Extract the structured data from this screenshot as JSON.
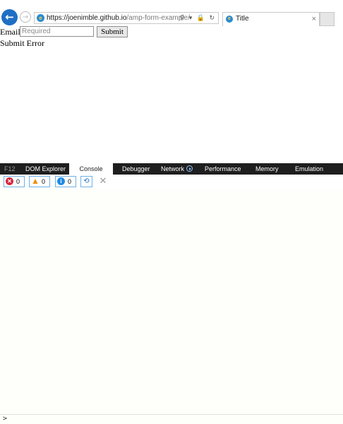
{
  "browser": {
    "url_host": "https://joenimble.github.io",
    "url_path": "/amp-form-example/",
    "address_icons": "⚲ ▾ 🔒 ↻",
    "tab_title": "Title",
    "tab_close": "×",
    "back_glyph": "←",
    "forward_glyph": "→",
    "site_icon": "e"
  },
  "page": {
    "email_label": "Email",
    "email_placeholder": "Required",
    "email_value": "",
    "submit_label": "Submit",
    "submit_error": "Submit Error"
  },
  "devtools": {
    "tabs": {
      "f12": "F12",
      "dom_explorer": "DOM Explorer",
      "console": "Console",
      "debugger": "Debugger",
      "network": "Network",
      "performance": "Performance",
      "memory": "Memory",
      "emulation": "Emulation"
    },
    "active_tab": "Console",
    "filters": {
      "errors": {
        "icon": "error-icon",
        "glyph": "✕",
        "count": "0"
      },
      "warnings": {
        "icon": "warning-icon",
        "glyph": "▲",
        "count": "0"
      },
      "messages": {
        "icon": "info-icon",
        "glyph": "i",
        "count": "0"
      }
    },
    "clear_on_navigate_glyph": "⟲",
    "clear_glyph": "✕",
    "prompt_glyph": ">"
  },
  "colors": {
    "accent": "#1f6fc5",
    "devtools_bar": "#1e1e1e",
    "error": "#d7263d",
    "warning": "#f08c00",
    "info": "#1f8ce6"
  }
}
